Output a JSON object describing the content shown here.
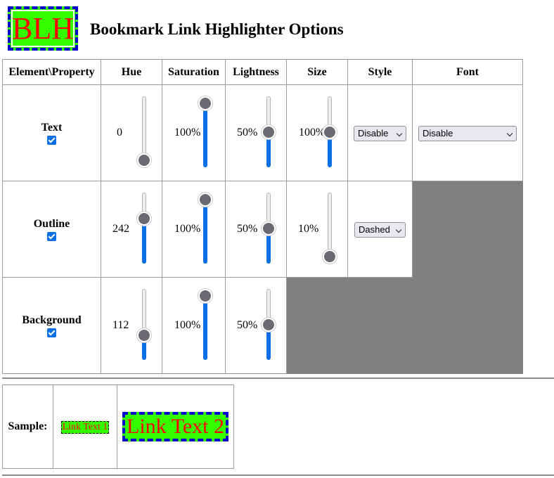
{
  "header": {
    "logo_text": "BLH",
    "title": "Bookmark Link Highlighter Options"
  },
  "table": {
    "columns": [
      "Element\\Property",
      "Hue",
      "Saturation",
      "Lightness",
      "Size",
      "Style",
      "Font"
    ],
    "rows": {
      "text": {
        "label": "Text",
        "enabled": true,
        "hue": {
          "value": "0",
          "fraction": 0.0
        },
        "saturation": {
          "value": "100%",
          "fraction": 1.0
        },
        "lightness": {
          "value": "50%",
          "fraction": 0.5
        },
        "size": {
          "value": "100%",
          "fraction": 0.5
        },
        "style": "Disable",
        "font": "Disable"
      },
      "outline": {
        "label": "Outline",
        "enabled": true,
        "hue": {
          "value": "242",
          "fraction": 0.67
        },
        "saturation": {
          "value": "100%",
          "fraction": 1.0
        },
        "lightness": {
          "value": "50%",
          "fraction": 0.5
        },
        "size": {
          "value": "10%",
          "fraction": 0.0
        },
        "style": "Dashed"
      },
      "background": {
        "label": "Background",
        "enabled": true,
        "hue": {
          "value": "112",
          "fraction": 0.31
        },
        "saturation": {
          "value": "100%",
          "fraction": 1.0
        },
        "lightness": {
          "value": "50%",
          "fraction": 0.5
        }
      }
    }
  },
  "sample": {
    "label": "Sample:",
    "link1": "Link Text 1",
    "link2": "Link Text 2"
  },
  "colors": {
    "accent": "#0d6fe6",
    "highlight_bg": "#33ff00",
    "highlight_text": "#ff0000",
    "outline": "#0000cc",
    "disabled_cell": "#808080"
  }
}
